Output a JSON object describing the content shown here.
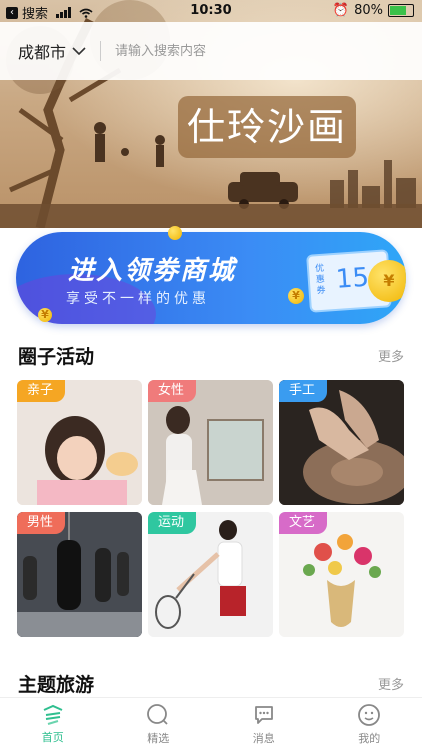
{
  "status_bar": {
    "back_app": "搜索",
    "time": "10:30",
    "battery": "80%",
    "battery_level": 0.8
  },
  "header": {
    "city": "成都市",
    "search_placeholder": "请输入搜索内容"
  },
  "hero": {
    "title": "仕玲沙画"
  },
  "coupon_banner": {
    "title": "进入领劵商城",
    "subtitle": "享受不一样的优惠",
    "ticket_label": "优惠券",
    "ticket_value": "15",
    "coin_symbol": "¥"
  },
  "circle_section": {
    "title": "圈子活动",
    "more": "更多",
    "cards": [
      {
        "tag": "亲子",
        "tag_color": "#f5a623"
      },
      {
        "tag": "女性",
        "tag_color": "#f07b7b"
      },
      {
        "tag": "手工",
        "tag_color": "#3a9cf0"
      },
      {
        "tag": "男性",
        "tag_color": "#ef6d5a"
      },
      {
        "tag": "运动",
        "tag_color": "#2fc7a0"
      },
      {
        "tag": "文艺",
        "tag_color": "#d76bc8"
      }
    ]
  },
  "travel_section": {
    "title": "主题旅游",
    "more": "更多"
  },
  "tabbar": {
    "items": [
      {
        "label": "首页",
        "icon": "home-icon"
      },
      {
        "label": "精选",
        "icon": "search-circle-icon"
      },
      {
        "label": "消息",
        "icon": "message-icon"
      },
      {
        "label": "我的",
        "icon": "profile-icon"
      }
    ],
    "active_color": "#2fbf8f"
  }
}
